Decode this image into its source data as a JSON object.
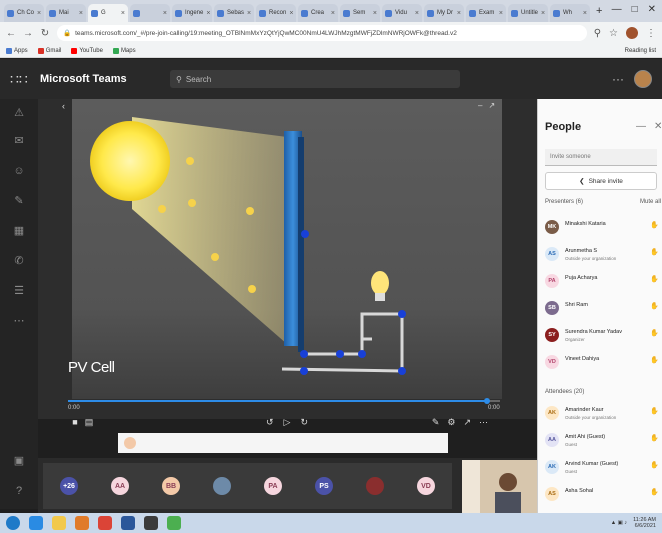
{
  "browser": {
    "tabs": [
      "Ch Co",
      "Mai",
      "G",
      "",
      "Ingene",
      "Sebas",
      "Recon",
      "Crea",
      "Sem",
      "Vidu",
      "My Dr",
      "Exam",
      "Untitle",
      "Wh"
    ],
    "new_tab": "+",
    "address": "teams.microsoft.com/_#/pre-join-calling/19:meeting_OTBlNmMxYzQtYjQwMC00NmU4LWJhMzgtMWFjZDlmNWRjOWFk@thread.v2",
    "bookmarks": [
      "Apps",
      "Gmail",
      "YouTube",
      "Maps"
    ],
    "reading_list": "Reading list",
    "colors": {
      "tabstrip": "#d3d9e3",
      "accent": "#4a7bd0"
    }
  },
  "teams": {
    "app_title": "Microsoft Teams",
    "search_placeholder": "Search",
    "more": "···"
  },
  "video": {
    "caption": "PV Cell",
    "time_left": "0:00",
    "time_right": "0:00",
    "progress": 0.97
  },
  "people_panel": {
    "title": "People",
    "invite_placeholder": "Invite someone",
    "share_invite": "Share invite",
    "presenters_heading": "Presenters (6)",
    "attendees_heading": "Attendees (20)",
    "mute_all": "Mute all",
    "presenters": [
      {
        "initials": "MK",
        "name": "Minakshi Kataria",
        "sub": "",
        "color": "#7a5c48",
        "text": "#fff"
      },
      {
        "initials": "AS",
        "name": "Arunmetha S",
        "sub": "Outside your organization",
        "color": "#dbe9f7",
        "text": "#2b6bb5"
      },
      {
        "initials": "PA",
        "name": "Puja Acharya",
        "sub": "",
        "color": "#f8d8e2",
        "text": "#b2456d"
      },
      {
        "initials": "SB",
        "name": "Shri Ram",
        "sub": "",
        "color": "#7c6b8e",
        "text": "#fff"
      },
      {
        "initials": "SY",
        "name": "Surendra Kumar Yadav",
        "sub": "Organizer",
        "color": "#8b1e1e",
        "text": "#fff"
      },
      {
        "initials": "VD",
        "name": "Vineet Dahiya",
        "sub": "",
        "color": "#f8d8e2",
        "text": "#b2456d"
      }
    ],
    "attendees": [
      {
        "initials": "AK",
        "name": "Amarinder Kaur",
        "sub": "Outside your organization",
        "color": "#fde7c5",
        "text": "#a86b12"
      },
      {
        "initials": "AA",
        "name": "Amit Ahi (Guest)",
        "sub": "Guest",
        "color": "#e3e3f5",
        "text": "#55559b"
      },
      {
        "initials": "AK",
        "name": "Arvind Kumar (Guest)",
        "sub": "Guest",
        "color": "#dbe9f7",
        "text": "#2b6bb5"
      },
      {
        "initials": "AS",
        "name": "Asha Sohal",
        "sub": "",
        "color": "#fde7c5",
        "text": "#a86b12"
      }
    ]
  },
  "participants": [
    {
      "initials": "+26",
      "color": "#4b52a8"
    },
    {
      "initials": "AA",
      "color": "#f6d6de"
    },
    {
      "initials": "BB",
      "color": "#f3c9a8"
    },
    {
      "initials": "",
      "color": "#6d8aa8"
    },
    {
      "initials": "PA",
      "color": "#f6d6de"
    },
    {
      "initials": "PS",
      "color": "#4b52a8"
    },
    {
      "initials": "",
      "color": "#8a2e2e"
    },
    {
      "initials": "VD",
      "color": "#f6d6de"
    }
  ],
  "taskbar": {
    "time": "11:26 AM",
    "date": "6/6/2021",
    "apps": [
      "windows-start",
      "internet-explorer",
      "file-explorer",
      "media-player",
      "chrome",
      "word",
      "powerpoint",
      "photos"
    ]
  }
}
